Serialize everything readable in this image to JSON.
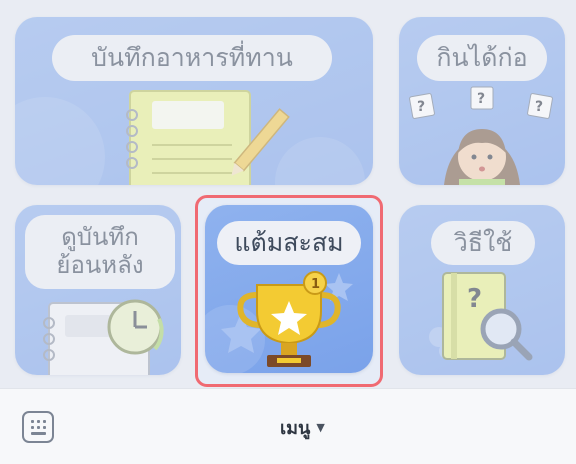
{
  "menu": {
    "tiles": [
      {
        "label": "บันทึกอาหารที่ทาน",
        "icon": "notebook-pencil-icon"
      },
      {
        "label": "กินได้ก่อ",
        "icon": "confused-person-icon"
      },
      {
        "label_line1": "ดูบันทึก",
        "label_line2": "ย้อนหลัง",
        "icon": "history-notebook-clock-icon"
      },
      {
        "label": "แต้มสะสม",
        "icon": "trophy-star-icon",
        "badge": "1"
      },
      {
        "label": "วิธีใช้",
        "icon": "magnifier-book-icon"
      }
    ],
    "highlight_color": "#f06a72"
  },
  "bottom_bar": {
    "menu_label": "เมนู",
    "caret": "▼",
    "keyboard_icon": "keyboard-icon"
  }
}
